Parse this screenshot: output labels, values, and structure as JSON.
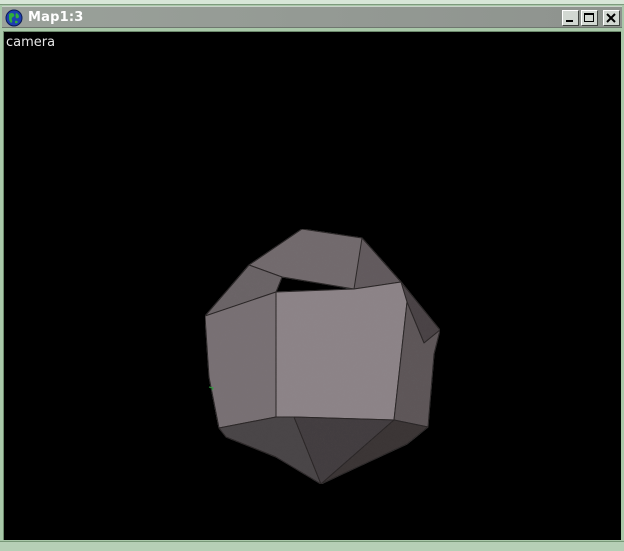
{
  "window": {
    "title": "Map1:3",
    "controls": {
      "minimize": "minimize",
      "maximize": "maximize",
      "close": "close"
    }
  },
  "viewport": {
    "label": "camera",
    "background": "#000000"
  },
  "icons": {
    "app": "globe-icon",
    "minimize": "minimize-icon",
    "maximize": "maximize-icon",
    "close": "close-icon"
  },
  "colors": {
    "frame": "#a9c8a9",
    "titlebar": "#9aa19a",
    "object_light": "#8a8285",
    "object_dark": "#3a3536"
  }
}
